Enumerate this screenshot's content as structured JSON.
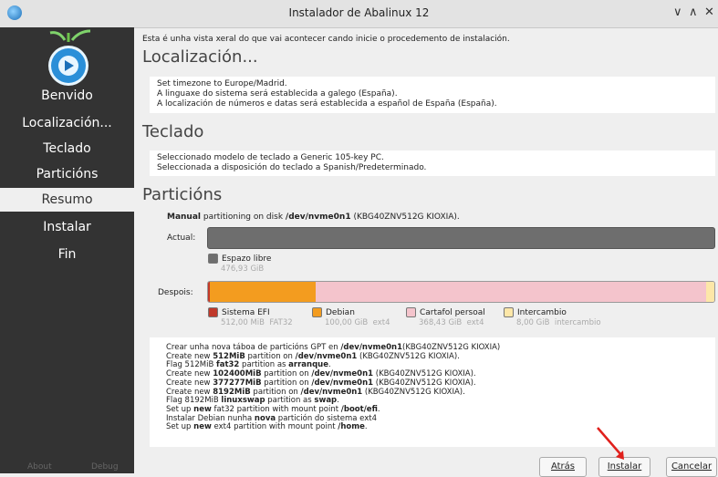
{
  "window": {
    "title": "Instalador de Abalinux 12",
    "controls": [
      "∨",
      "∧",
      "✕"
    ]
  },
  "sidebar": {
    "items": [
      {
        "label": "Benvido"
      },
      {
        "label": "Localización..."
      },
      {
        "label": "Teclado"
      },
      {
        "label": "Particións"
      },
      {
        "label": "Resumo",
        "active": true
      },
      {
        "label": "Instalar"
      },
      {
        "label": "Fin"
      }
    ],
    "about_label": "About",
    "debug_label": "Debug"
  },
  "summary": {
    "intro": "Esta é unha vista xeral do que vai acontecer cando inicie o procedemento de instalación.",
    "location": {
      "title": "Localización...",
      "lines": [
        "Set timezone to Europe/Madrid.",
        "A linguaxe do sistema será establecida a galego (España).",
        "A localización de números e datas será establecida a español de España (España)."
      ]
    },
    "keyboard": {
      "title": "Teclado",
      "lines": [
        "Seleccionado modelo de teclado a Generic 105-key PC.",
        "Seleccionada a disposición do teclado a Spanish/Predeterminado."
      ]
    },
    "partitions": {
      "title": "Particións",
      "mode": "Manual",
      "text_middle": " partitioning on disk ",
      "disk": "/dev/nvme0n1",
      "model": " (KBG40ZNV512G KIOXIA).",
      "actual_label": "Actual:",
      "after_label": "Despois:",
      "actual_legend": {
        "name": "Espazo libre",
        "size": "476,93 GiB",
        "color": "#6e6e6e"
      },
      "after_segments": [
        {
          "name": "Sistema EFI",
          "size": "512,00 MiB",
          "fs": "FAT32",
          "color": "#c0392b",
          "fraction": 0.004
        },
        {
          "name": "Debian",
          "size": "100,00 GiB",
          "fs": "ext4",
          "color": "#f39c1f",
          "fraction": 0.21
        },
        {
          "name": "Cartafol persoal",
          "size": "368,43 GiB",
          "fs": "ext4",
          "color": "#f4c4cc",
          "fraction": 0.772
        },
        {
          "name": "Intercambio",
          "size": "8,00 GiB",
          "fs": "intercambio",
          "color": "#fde7a8",
          "fraction": 0.017
        }
      ]
    },
    "operations": [
      [
        {
          "t": "Crear unha nova táboa de particións GPT en "
        },
        {
          "t": "/dev/nvme0n1",
          "b": true
        },
        {
          "t": "(KBG40ZNV512G KIOXIA)"
        }
      ],
      [
        {
          "t": "Create new "
        },
        {
          "t": "512MiB",
          "b": true
        },
        {
          "t": " partition on "
        },
        {
          "t": "/dev/nvme0n1",
          "b": true
        },
        {
          "t": " (KBG40ZNV512G KIOXIA)."
        }
      ],
      [
        {
          "t": "Flag 512MiB "
        },
        {
          "t": "fat32",
          "b": true
        },
        {
          "t": " partition as "
        },
        {
          "t": "arranque",
          "b": true
        },
        {
          "t": "."
        }
      ],
      [
        {
          "t": "Create new "
        },
        {
          "t": "102400MiB",
          "b": true
        },
        {
          "t": " partition on "
        },
        {
          "t": "/dev/nvme0n1",
          "b": true
        },
        {
          "t": " (KBG40ZNV512G KIOXIA)."
        }
      ],
      [
        {
          "t": "Create new "
        },
        {
          "t": "377277MiB",
          "b": true
        },
        {
          "t": " partition on "
        },
        {
          "t": "/dev/nvme0n1",
          "b": true
        },
        {
          "t": " (KBG40ZNV512G KIOXIA)."
        }
      ],
      [
        {
          "t": "Create new "
        },
        {
          "t": "8192MiB",
          "b": true
        },
        {
          "t": " partition on "
        },
        {
          "t": "/dev/nvme0n1",
          "b": true
        },
        {
          "t": " (KBG40ZNV512G KIOXIA)."
        }
      ],
      [
        {
          "t": "Flag 8192MiB "
        },
        {
          "t": "linuxswap",
          "b": true
        },
        {
          "t": " partition as "
        },
        {
          "t": "swap",
          "b": true
        },
        {
          "t": "."
        }
      ],
      [
        {
          "t": "Set up "
        },
        {
          "t": "new",
          "b": true
        },
        {
          "t": " fat32 partition with mount point "
        },
        {
          "t": "/boot/efi",
          "b": true
        },
        {
          "t": "."
        }
      ],
      [
        {
          "t": "Instalar Debian nunha "
        },
        {
          "t": "nova",
          "b": true
        },
        {
          "t": " partición do sistema ext4"
        }
      ],
      [
        {
          "t": "Set up "
        },
        {
          "t": "new",
          "b": true
        },
        {
          "t": " ext4 partition with mount point "
        },
        {
          "t": "/home",
          "b": true
        },
        {
          "t": "."
        }
      ]
    ]
  },
  "buttons": {
    "back": "Atrás",
    "install": "Instalar",
    "cancel": "Cancelar"
  },
  "annotation_color": "#e0201c"
}
